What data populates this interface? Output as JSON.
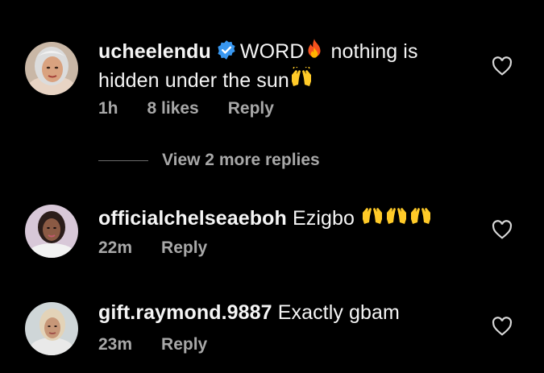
{
  "comments": [
    {
      "username": "ucheelendu",
      "verified": true,
      "text_before_fire": "WORD",
      "text_after_fire": " nothing is hidden under the sun",
      "emojis": [
        "fire-emoji",
        "raising-hands-emoji"
      ],
      "time": "1h",
      "likes": "8 likes",
      "reply_label": "Reply"
    },
    {
      "username": "officialchelseaeboh",
      "verified": false,
      "text": "Ezigbo ",
      "emojis": [
        "raising-hands-emoji",
        "raising-hands-emoji",
        "raising-hands-emoji"
      ],
      "time": "22m",
      "reply_label": "Reply"
    },
    {
      "username": "gift.raymond.9887",
      "verified": false,
      "text": "Exactly gbam",
      "time": "23m",
      "reply_label": "Reply"
    }
  ],
  "view_more_replies": "View 2 more replies",
  "colors": {
    "background": "#000000",
    "text": "#f5f5f5",
    "meta": "#a8a8a8",
    "verified": "#3897f0"
  }
}
